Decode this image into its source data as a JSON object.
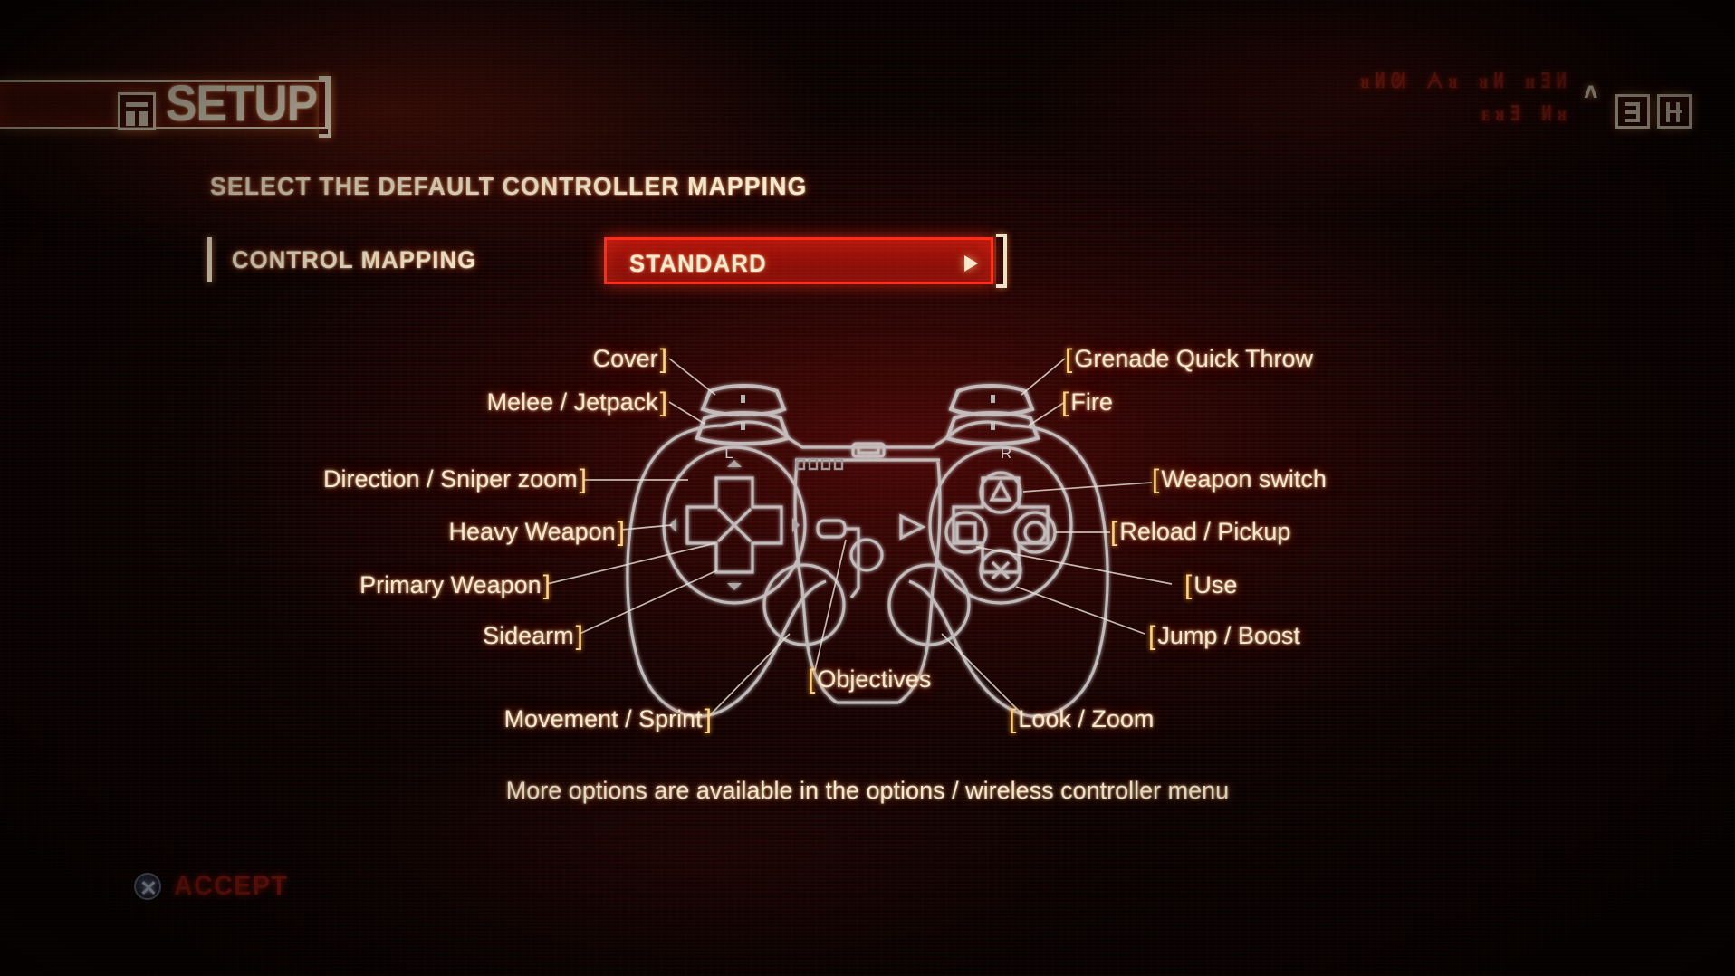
{
  "header": {
    "title": "SETUP",
    "icon": "setup-panel-icon",
    "subtitle": "SELECT THE DEFAULT CONTROLLER MAPPING",
    "glyph_line_1": "ᴚИᘛ ᗅᴚ ᴚИ ᴎƎИ",
    "glyph_line_2": "ᴇᴚƎ Иᴚ",
    "glyph_caret": "ᴧ",
    "hud_icons": [
      "hud-glyph-box-left",
      "hud-glyph-box-right"
    ]
  },
  "control_mapping": {
    "label": "CONTROL MAPPING",
    "value": "STANDARD",
    "options": [
      "STANDARD"
    ],
    "arrow": "right-arrow-icon",
    "accent_color": "#ff2a18"
  },
  "callouts": {
    "left": [
      {
        "text": "Cover",
        "bracket": "]"
      },
      {
        "text": "Melee / Jetpack",
        "bracket": "]"
      },
      {
        "text": "Direction / Sniper zoom",
        "bracket": "]"
      },
      {
        "text": "Heavy Weapon",
        "bracket": "]"
      },
      {
        "text": "Primary Weapon",
        "bracket": "]"
      },
      {
        "text": "Sidearm",
        "bracket": "]"
      },
      {
        "text": "Movement / Sprint",
        "bracket": "]"
      }
    ],
    "center": [
      {
        "text": "Objectives",
        "bracket": "["
      }
    ],
    "right": [
      {
        "text": "Grenade Quick Throw",
        "bracket": "["
      },
      {
        "text": "Fire",
        "bracket": "["
      },
      {
        "text": "Weapon switch",
        "bracket": "["
      },
      {
        "text": "Reload / Pickup",
        "bracket": "["
      },
      {
        "text": "Use",
        "bracket": "["
      },
      {
        "text": "Jump / Boost",
        "bracket": "["
      },
      {
        "text": "Look / Zoom",
        "bracket": "["
      }
    ]
  },
  "controller": {
    "type": "dualshock-gamepad-diagram",
    "shoulder_left_label": "L",
    "shoulder_right_label": "R",
    "led_count": 4,
    "face_buttons": [
      "triangle",
      "circle",
      "square",
      "cross"
    ],
    "line_color": "#d8d8d8"
  },
  "footer": {
    "note": "More options are available in the options / wireless controller menu",
    "accept_icon": "playstation-cross-button-icon",
    "accept_label": "ACCEPT"
  }
}
